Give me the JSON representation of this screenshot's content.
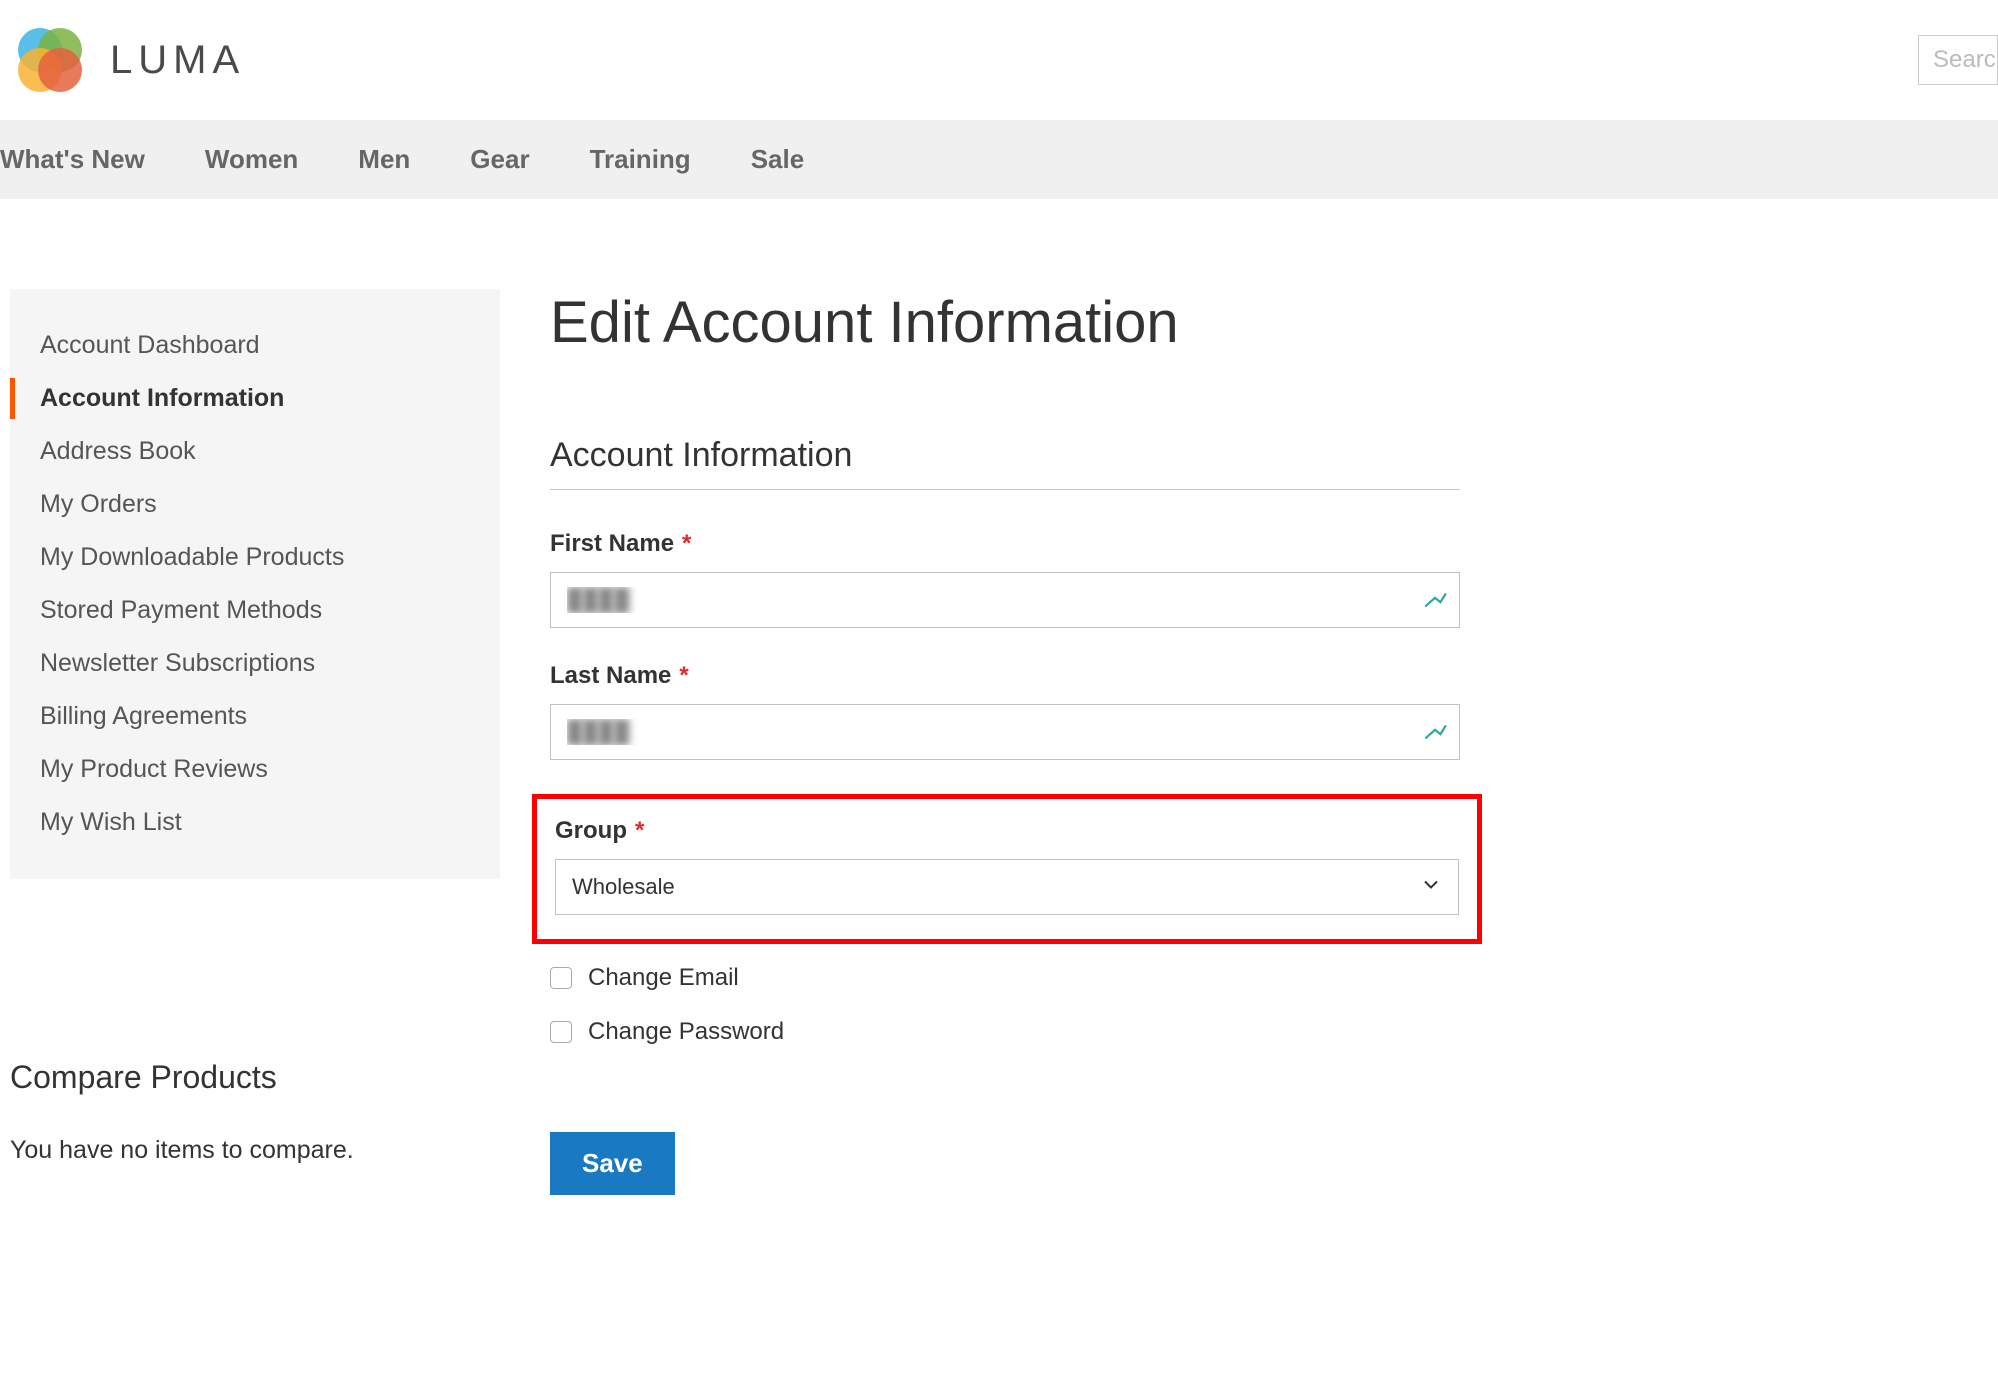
{
  "brand": "LUMA",
  "search": {
    "placeholder": "Search"
  },
  "nav": {
    "items": [
      "What's New",
      "Women",
      "Men",
      "Gear",
      "Training",
      "Sale"
    ]
  },
  "sidebar": {
    "items": [
      {
        "label": "Account Dashboard",
        "active": false
      },
      {
        "label": "Account Information",
        "active": true
      },
      {
        "label": "Address Book",
        "active": false
      },
      {
        "label": "My Orders",
        "active": false
      },
      {
        "label": "My Downloadable Products",
        "active": false
      },
      {
        "label": "Stored Payment Methods",
        "active": false
      },
      {
        "label": "Newsletter Subscriptions",
        "active": false
      },
      {
        "label": "Billing Agreements",
        "active": false
      },
      {
        "label": "My Product Reviews",
        "active": false
      },
      {
        "label": "My Wish List",
        "active": false
      }
    ]
  },
  "compare": {
    "title": "Compare Products",
    "empty": "You have no items to compare."
  },
  "page": {
    "title": "Edit Account Information",
    "section_title": "Account Information"
  },
  "form": {
    "first_name_label": "First Name",
    "first_name_value": "████",
    "last_name_label": "Last Name",
    "last_name_value": "████",
    "group_label": "Group",
    "group_value": "Wholesale",
    "change_email_label": "Change Email",
    "change_password_label": "Change Password",
    "save_label": "Save"
  }
}
